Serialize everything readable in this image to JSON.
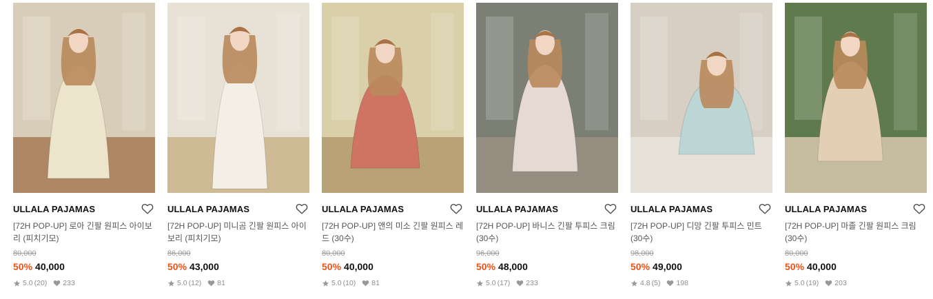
{
  "products": [
    {
      "brand": "ULLALA PAJAMAS",
      "title": "[72H POP-UP] 로아 긴팔 원피스 아이보리 (피치기모)",
      "original_price": "80,000",
      "discount": "50%",
      "price": "40,000",
      "rating": "5.0",
      "reviews": "(20)",
      "likes": "233",
      "image_desc": "woman in ivory ruffled long-sleeve dress in classic interior",
      "colors": {
        "bg": "#d8cdb8",
        "garment": "#ede4cc",
        "floor": "#a77a55"
      }
    },
    {
      "brand": "ULLALA PAJAMAS",
      "title": "[72H POP-UP] 미니곰 긴팔 원피스 아이보리 (피치기모)",
      "original_price": "86,000",
      "discount": "50%",
      "price": "43,000",
      "rating": "5.0",
      "reviews": "(12)",
      "likes": "81",
      "image_desc": "woman in white patterned nightdress with lace collar",
      "colors": {
        "bg": "#e8e2d6",
        "garment": "#f3efe6",
        "floor": "#c9b38a"
      }
    },
    {
      "brand": "ULLALA PAJAMAS",
      "title": "[72H POP-UP] 앤의 미소 긴팔 원피스 레드 (30수)",
      "original_price": "80,000",
      "discount": "50%",
      "price": "40,000",
      "rating": "5.0",
      "reviews": "(10)",
      "likes": "81",
      "image_desc": "girl in red gingham dress sitting on woven rug",
      "colors": {
        "bg": "#d9cfa8",
        "garment": "#cf7363",
        "floor": "#b39a6c"
      }
    },
    {
      "brand": "ULLALA PAJAMAS",
      "title": "[72H POP-UP] 바니스 긴팔 투피스 크림 (30수)",
      "original_price": "96,000",
      "discount": "50%",
      "price": "48,000",
      "rating": "5.0",
      "reviews": "(17)",
      "likes": "233",
      "image_desc": "woman in cream floral two-piece pajamas sitting on chair",
      "colors": {
        "bg": "#7b7f74",
        "garment": "#e6d8d2",
        "floor": "#9a8f83"
      }
    },
    {
      "brand": "ULLALA PAJAMAS",
      "title": "[72H POP-UP] 디망 긴팔 투피스 민트 (30수)",
      "original_price": "98,000",
      "discount": "50%",
      "price": "49,000",
      "rating": "4.8",
      "reviews": "(5)",
      "likes": "198",
      "image_desc": "woman in mint two-piece pajamas lounging outdoors",
      "colors": {
        "bg": "#d7cfc4",
        "garment": "#bcd6d6",
        "floor": "#e9e5de"
      }
    },
    {
      "brand": "ULLALA PAJAMAS",
      "title": "[72H POP-UP] 마졸 긴팔 원피스 크림 (30수)",
      "original_price": "80,000",
      "discount": "50%",
      "price": "40,000",
      "rating": "5.0",
      "reviews": "(19)",
      "likes": "203",
      "image_desc": "woman in cream floral dress at garden table with food",
      "colors": {
        "bg": "#5f7a4c",
        "garment": "#e3cfb4",
        "floor": "#d8c9b0"
      }
    }
  ],
  "accent_color": "#e8541a",
  "icons": {
    "wishlist": "heart-outline-icon",
    "rating": "star-icon",
    "likes": "heart-filled-icon"
  }
}
